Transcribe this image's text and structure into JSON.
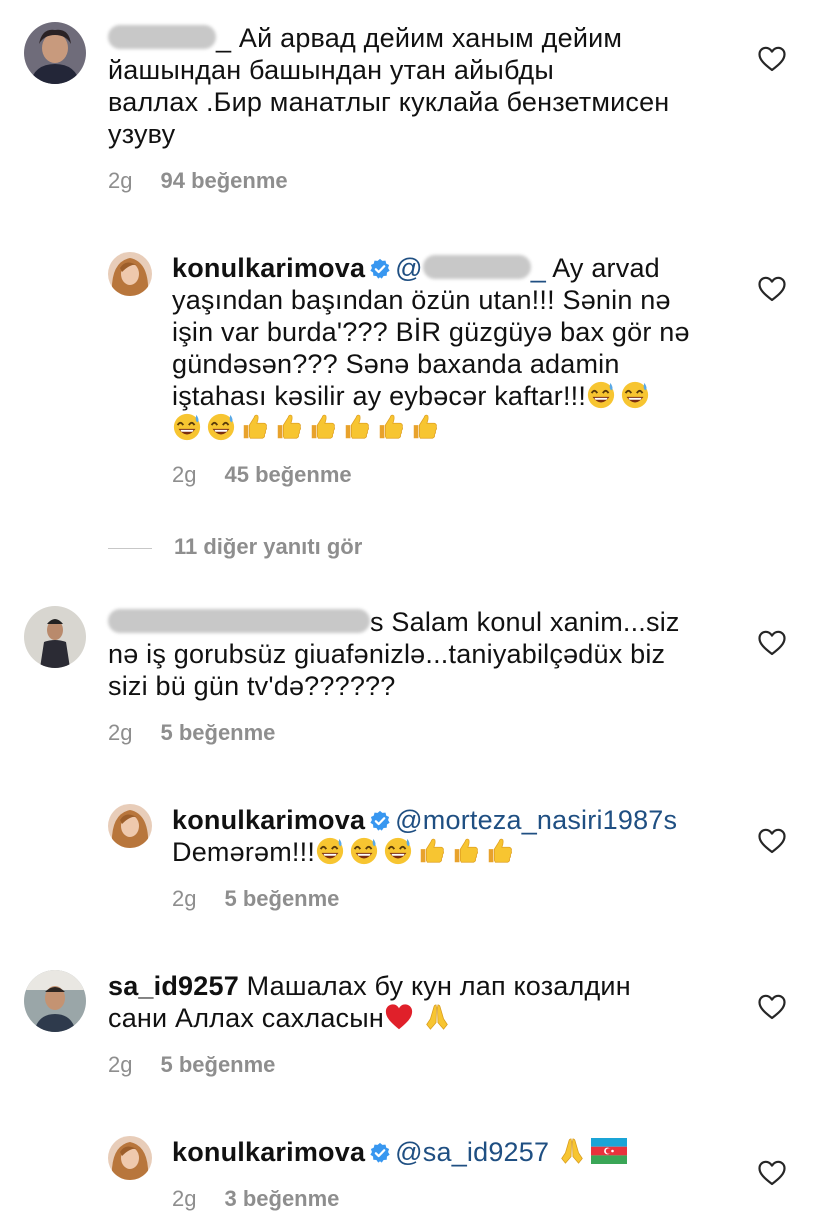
{
  "comments": [
    {
      "id": "c1",
      "text": "_ Ай арвад дейим ханым дейим йашындан башындан утан айыбды валлах .Бир манатлыг куклайа бензетмисен узуву",
      "line1_tail": "_ Ай арвад дейим ханым дейим",
      "line2": "йашындан башындан утан айыбды",
      "line3": "валлах .Бир манатлыг куклайа бензетмисен",
      "line4": "узуву",
      "time": "2g",
      "likes": "94 beğenme"
    },
    {
      "id": "r1",
      "username": "konulkarimova",
      "mention_tail": "_",
      "line1_tail": " Ay arvad",
      "line2": "yaşından başından özün utan!!! Sənin nə",
      "line3": "işin var burda'??? BİR güzgüyə bax gör nə",
      "line4": "gündəsən??? Sənə baxanda adamin",
      "line5": "iştahası kəsilir ay eybəcər kaftar!!!",
      "time": "2g",
      "likes": "45 beğenme"
    },
    {
      "id": "view-more",
      "label": "11 diğer yanıtı gör"
    },
    {
      "id": "c2",
      "line1_tail": "s Salam konul xanim...siz",
      "line2": "nə iş gorubsüz giuafənizlə...taniyabilçədüx biz",
      "line3": "sizi bü gün tv'də??????",
      "time": "2g",
      "likes": "5 beğenme"
    },
    {
      "id": "r2",
      "username": "konulkarimova",
      "mention": "@morteza_nasiri1987s",
      "line2": "Demərəm!!!",
      "time": "2g",
      "likes": "5 beğenme"
    },
    {
      "id": "c3",
      "username": "sa_id9257",
      "line1_tail": " Машалах бу кун лап козалдин",
      "line2": "сани Аллах сахласын",
      "time": "2g",
      "likes": "5 beğenme"
    },
    {
      "id": "r3",
      "username": "konulkarimova",
      "mention": "@sa_id9257",
      "time": "2g",
      "likes": "3 beğenme"
    }
  ],
  "colors": {
    "mention": "#1f4f82",
    "meta": "#8e8e8e",
    "verified": "#3897f0"
  },
  "icons": [
    "heart-outline-icon",
    "verified-badge-icon",
    "grinning-sweat-emoji",
    "thumbs-up-emoji",
    "red-heart-emoji",
    "folded-hands-emoji",
    "azerbaijan-flag-emoji"
  ]
}
